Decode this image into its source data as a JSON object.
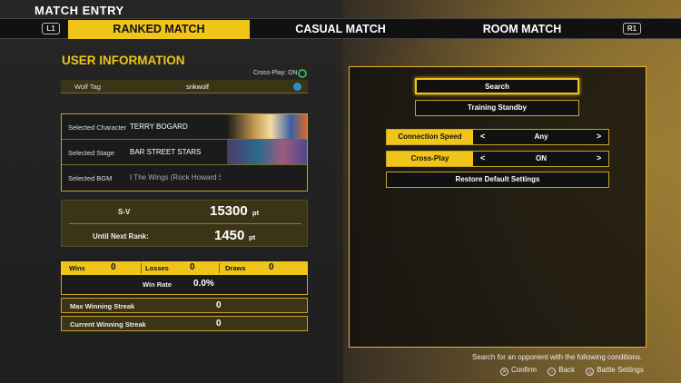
{
  "screen": {
    "title": "MATCH ENTRY"
  },
  "tabs": {
    "left_shoulder": "L1",
    "right_shoulder": "R1",
    "items": [
      {
        "label": "RANKED MATCH",
        "active": true
      },
      {
        "label": "CASUAL MATCH",
        "active": false
      },
      {
        "label": "ROOM MATCH",
        "active": false
      }
    ]
  },
  "user_info": {
    "title": "USER INFORMATION",
    "crossplay_status": "Cross-Play: ON",
    "wolf_tag_label": "Wolf Tag",
    "wolf_tag_value": "snkwolf",
    "selected": [
      {
        "label": "Selected Character",
        "value": "TERRY BOGARD"
      },
      {
        "label": "Selected Stage",
        "value": "BAR STREET STARS"
      },
      {
        "label": "Selected BGM",
        "value": "I The Wings (Rock Howard S"
      }
    ],
    "sv_label": "S-V",
    "sv_value": "15300",
    "sv_unit": "pt",
    "next_rank_label": "Until Next Rank:",
    "next_rank_value": "1450",
    "next_rank_unit": "pt",
    "wins_label": "Wins",
    "wins_value": "0",
    "losses_label": "Losses",
    "losses_value": "0",
    "draws_label": "Draws",
    "draws_value": "0",
    "win_rate_label": "Win Rate",
    "win_rate_value": "0.0%",
    "max_streak_label": "Max Winning Streak",
    "max_streak_value": "0",
    "current_streak_label": "Current Winning Streak",
    "current_streak_value": "0"
  },
  "search_panel": {
    "search_label": "Search",
    "training_label": "Training Standby",
    "connection_speed_label": "Connection Speed",
    "connection_speed_value": "Any",
    "crossplay_label": "Cross-Play",
    "crossplay_value": "ON",
    "arrow_left": "<",
    "arrow_right": ">",
    "restore_label": "Restore Default Settings"
  },
  "footer": {
    "note": "Search for an opponent with the following conditions.",
    "confirm_glyph": "✕",
    "confirm_label": "Confirm",
    "back_glyph": "○",
    "back_label": "Back",
    "battle_glyph": "△",
    "battle_label": "Battle Settings"
  },
  "colors": {
    "accent": "#f0c419",
    "panel": "#3b3417",
    "border": "#c9a227"
  }
}
